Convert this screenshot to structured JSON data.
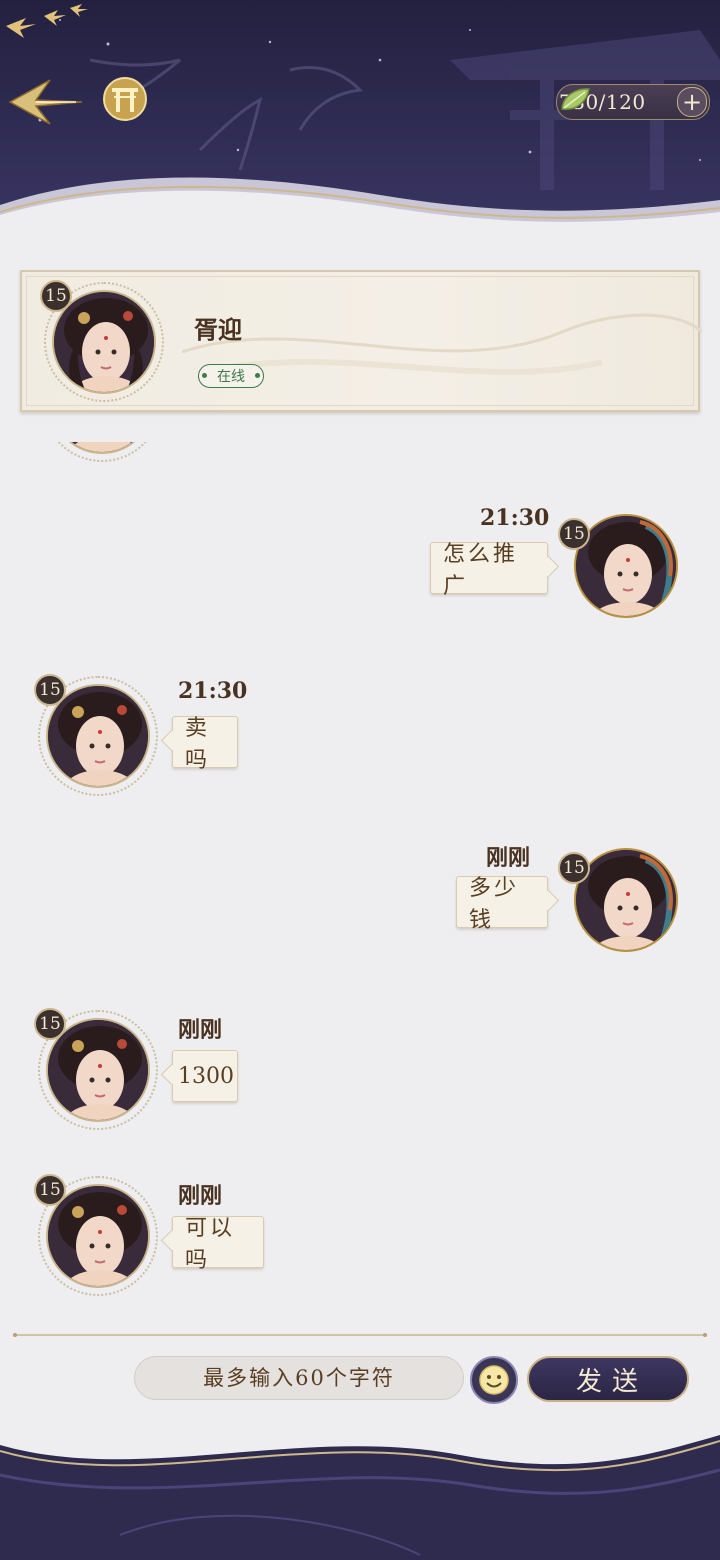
{
  "header": {
    "currency": {
      "amount": "730/120",
      "plus": "+"
    },
    "icons": [
      "back-arrow-icon",
      "gate-icon",
      "leaf-icon",
      "plus-icon"
    ]
  },
  "contact": {
    "name": "胥迎",
    "status": "在线",
    "level": "15"
  },
  "messages": [
    {
      "side": "right",
      "time": "21:30",
      "text": "怎么推广",
      "level": "15"
    },
    {
      "side": "left",
      "time": "21:30",
      "text": "卖吗",
      "level": "15"
    },
    {
      "side": "right",
      "time": "刚刚",
      "text": "多少钱",
      "level": "15"
    },
    {
      "side": "left",
      "time": "刚刚",
      "text": "1300",
      "level": "15"
    },
    {
      "side": "left",
      "time": "刚刚",
      "text": "可以吗",
      "level": "15"
    }
  ],
  "composer": {
    "placeholder": "最多输入60个字符",
    "send_label": "发送"
  },
  "colors": {
    "night_sky": "#2a2547",
    "paper": "#eeeef1",
    "gold": "#c9b68c",
    "online_green": "#3e7a4a"
  }
}
